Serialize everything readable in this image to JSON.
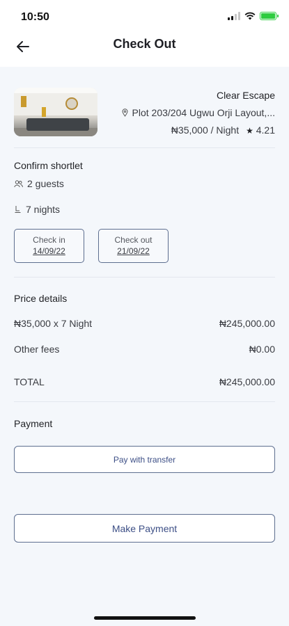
{
  "status_bar": {
    "time": "10:50",
    "battery_color": "#2ecc40"
  },
  "header": {
    "title": "Check Out",
    "back_icon": "arrow-left-icon"
  },
  "property": {
    "name": "Clear Escape",
    "address": "Plot 203/204 Ugwu Orji Layout,...",
    "price": "₦35,000 / Night",
    "rating": "4.21"
  },
  "booking": {
    "section_title": "Confirm shortlet",
    "guests": "2 guests",
    "nights": "7 nights",
    "check_in_label": "Check in",
    "check_in_date": "14/09/22",
    "check_out_label": "Check out",
    "check_out_date": "21/09/22"
  },
  "price_details": {
    "section_title": "Price details",
    "rows": [
      {
        "label": "₦35,000 x 7 Night",
        "value": "₦245,000.00"
      },
      {
        "label": "Other fees",
        "value": "₦0.00"
      }
    ],
    "total_label": "TOTAL",
    "total_value": "₦245,000.00"
  },
  "payment": {
    "section_title": "Payment",
    "transfer_button": "Pay with transfer",
    "make_payment_button": "Make Payment"
  },
  "colors": {
    "accent": "#3d4f86",
    "border": "#5d6e8f",
    "background": "#f4f7fb"
  }
}
